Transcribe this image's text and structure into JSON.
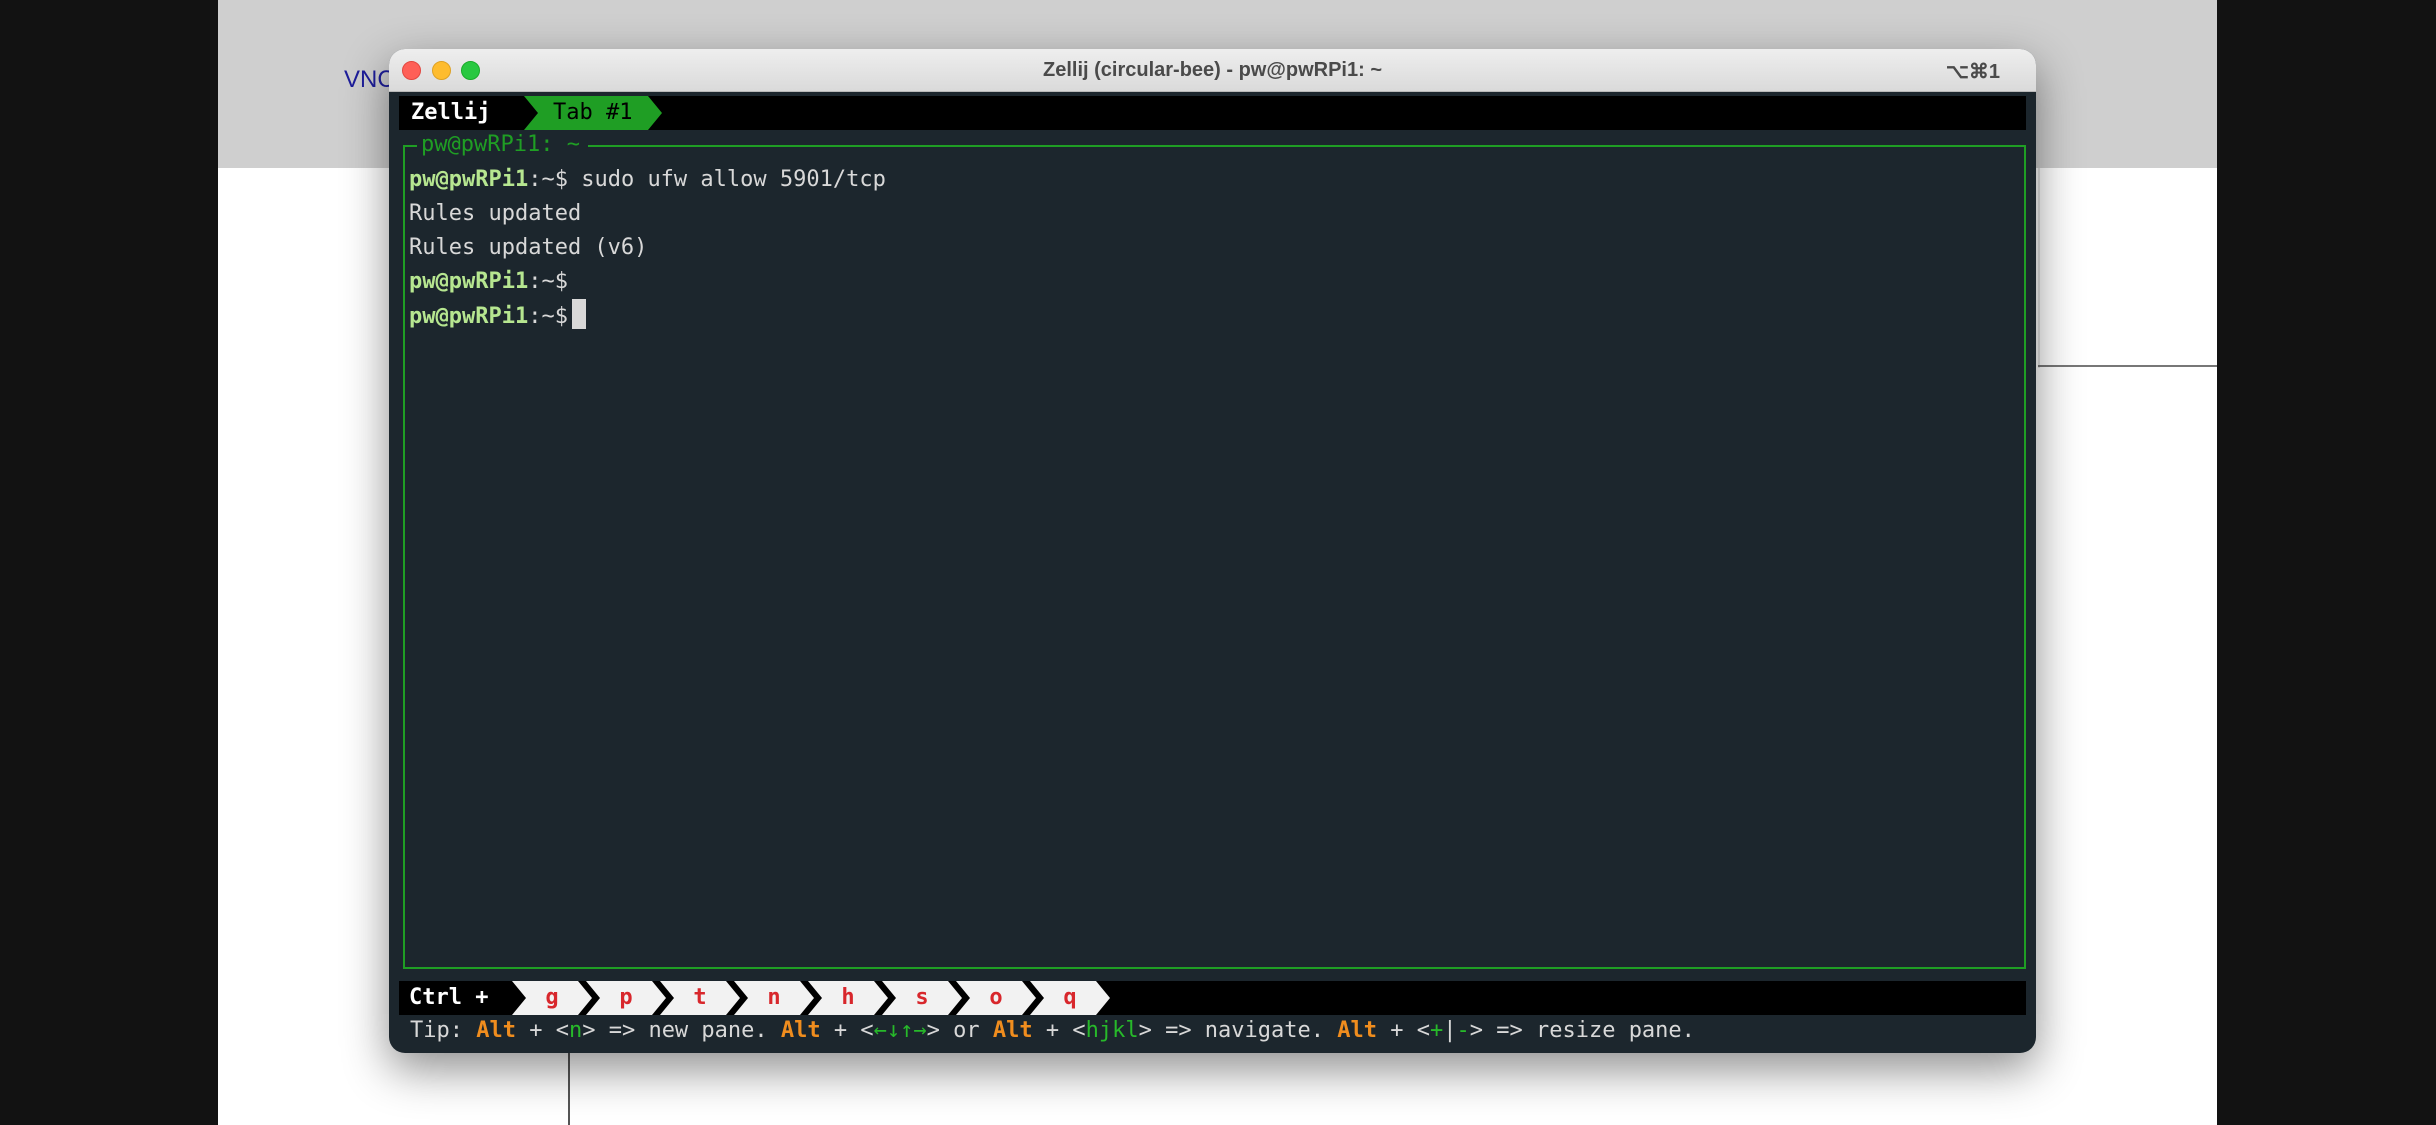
{
  "background": {
    "stage_label": "VNC"
  },
  "window": {
    "title": "Zellij (circular-bee) - pw@pwRPi1: ~",
    "shortcut": "⌥⌘1"
  },
  "tabbar": {
    "app_name": "Zellij",
    "active_tab": "Tab #1"
  },
  "pane": {
    "title": "pw@pwRPi1: ~"
  },
  "terminal": {
    "prompt": "pw@pwRPi1",
    "prompt_suffix": ":~$",
    "lines": [
      {
        "has_prompt": true,
        "text": " sudo ufw allow 5901/tcp"
      },
      {
        "has_prompt": false,
        "text": "Rules updated"
      },
      {
        "has_prompt": false,
        "text": "Rules updated (v6)"
      },
      {
        "has_prompt": true,
        "text": ""
      },
      {
        "has_prompt": true,
        "text": " ",
        "cursor": true
      }
    ]
  },
  "statusbar": {
    "label": "Ctrl +",
    "keys": [
      "g",
      "p",
      "t",
      "n",
      "h",
      "s",
      "o",
      "q"
    ]
  },
  "tip": {
    "prefix": "Tip: ",
    "alt": "Alt",
    "plus": " + <",
    "k1": "n",
    "t1": "> => new pane. ",
    "arrows": "←↓↑→",
    "t2": "> or ",
    "k3": "hjkl",
    "t3": "> => navigate. ",
    "k4a": "+",
    "bar": "|",
    "k4b": "-",
    "t4": "> => resize pane."
  },
  "colors": {
    "terminal_bg": "#1c262d",
    "accent_green": "#1f9e24",
    "prompt_green": "#b6e690",
    "key_red": "#d8272c",
    "tip_orange": "#f08d1e"
  }
}
